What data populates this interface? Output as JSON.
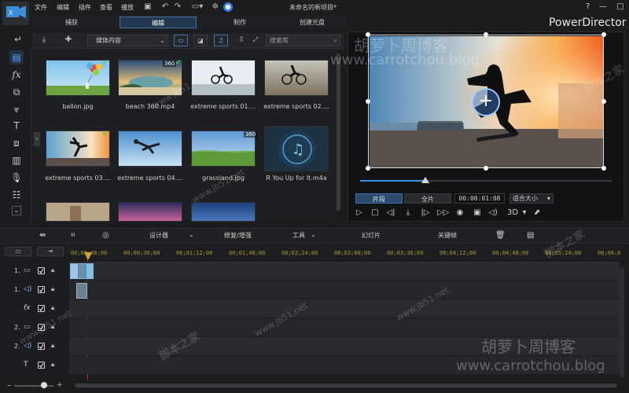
{
  "menu": [
    "文件",
    "编辑",
    "插件",
    "查看",
    "播放"
  ],
  "project_title": "未命名的新项目*",
  "window_controls": [
    "?",
    "—",
    "□"
  ],
  "tabs": [
    "捕获",
    "编辑",
    "制作",
    "创建光盘"
  ],
  "active_tab": "编辑",
  "brand": "PowerDirector",
  "library": {
    "dropdown": "媒体内容",
    "search_placeholder": "搜索库",
    "items": [
      {
        "label": "ballon.jpg",
        "badge": "",
        "checked": true
      },
      {
        "label": "beach 360.mp4",
        "badge": "360",
        "checked": true
      },
      {
        "label": "extreme sports 01....",
        "badge": "",
        "checked": false
      },
      {
        "label": "extreme sports 02....",
        "badge": "",
        "checked": false
      },
      {
        "label": "extreme sports 03....",
        "badge": "",
        "checked": true
      },
      {
        "label": "extreme sports 04....",
        "badge": "",
        "checked": false
      },
      {
        "label": "grassland.jpg",
        "badge": "360",
        "checked": false
      },
      {
        "label": "R You Up for It.m4a",
        "badge": "",
        "checked": false
      }
    ]
  },
  "preview": {
    "mode_clip": "片段",
    "mode_movie": "全片",
    "timecode": "00:00:01:08",
    "fit": "适合大小",
    "three_d": "3D"
  },
  "edit_toolbar": {
    "designer": "设计器",
    "fix": "修复/增强",
    "tools": "工具",
    "slideshow": "幻灯片",
    "keyframe": "关键帧"
  },
  "ruler_ticks": [
    "00;00;00;00",
    "00;00;36;00",
    "00;01;12;00",
    "00;01;48;00",
    "00;02;24;00",
    "00;03;00;00",
    "00;03;36;00",
    "00;04;12;00",
    "00;04;48;00",
    "00;05;24;00",
    "00;06:0"
  ],
  "tracks": [
    {
      "number": "1.",
      "type": "video-icon"
    },
    {
      "number": "1.",
      "type": "audio-icon"
    },
    {
      "number": "",
      "type": "fx-icon"
    },
    {
      "number": "2.",
      "type": "video-icon"
    },
    {
      "number": "2.",
      "type": "audio-icon"
    },
    {
      "number": "",
      "type": "title-icon"
    }
  ],
  "watermark": {
    "cn_top": "胡萝卜周博客",
    "url": "www.carrotchou.blog",
    "cn_bottom": "胡萝卜周博客",
    "jb51": "www.jb51.net",
    "jb51_cn": "脚本之家"
  }
}
